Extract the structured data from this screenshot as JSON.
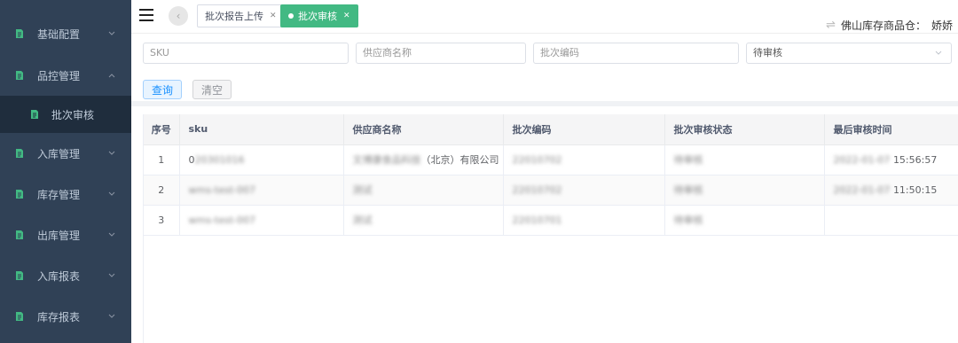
{
  "sidebar": {
    "items": [
      {
        "label": "基础配置"
      },
      {
        "label": "品控管理"
      },
      {
        "label": "入库管理"
      },
      {
        "label": "库存管理"
      },
      {
        "label": "出库管理"
      },
      {
        "label": "入库报表"
      },
      {
        "label": "库存报表"
      }
    ],
    "submenu_label": "批次审核"
  },
  "topbar": {
    "tabs": [
      {
        "label": "批次报告上传"
      },
      {
        "label": "批次审核"
      }
    ],
    "warehouse_label": "佛山库存商品仓：",
    "user_name": "娇娇"
  },
  "filters": {
    "sku_placeholder": "SKU",
    "supplier_placeholder": "供应商名称",
    "batch_placeholder": "批次编码",
    "status_value": "待审核",
    "query_label": "查询",
    "clear_label": "清空"
  },
  "table": {
    "headers": [
      "序号",
      "sku",
      "供应商名称",
      "批次编码",
      "批次审核状态",
      "最后审核时间"
    ],
    "rows": [
      {
        "idx": "1",
        "sku_prefix": "0",
        "sku_blur": "20301016",
        "supplier": "文博康食品科技",
        "supplier_tail": "（北京）有限公司",
        "batch": "22010702",
        "status": "待审核",
        "date": "2022-01-07",
        "time": "15:56:57"
      },
      {
        "idx": "2",
        "sku_prefix": "",
        "sku_blur": "wms-test-007",
        "supplier": "测试",
        "supplier_tail": "",
        "batch": "22010702",
        "status": "待审核",
        "date": "2022-01-07",
        "time": "11:50:15"
      },
      {
        "idx": "3",
        "sku_prefix": "",
        "sku_blur": "wms-test-007",
        "supplier": "测试",
        "supplier_tail": "",
        "batch": "22010701",
        "status": "待审核",
        "date": "",
        "time": ""
      }
    ]
  },
  "colors": {
    "sidebar_bg": "#304156",
    "active_tab": "#42b983",
    "menu_icon": "#42b983"
  }
}
